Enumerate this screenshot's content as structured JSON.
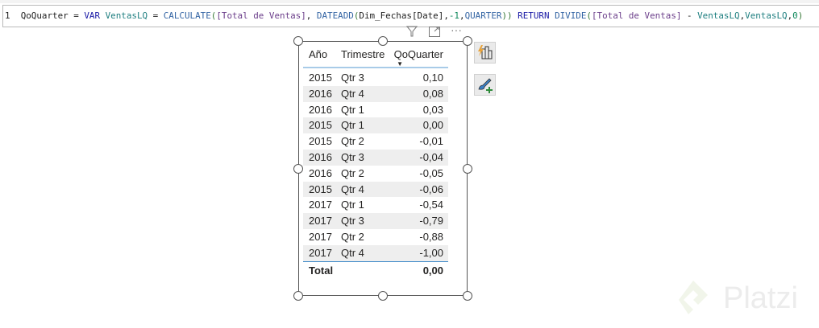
{
  "formula": {
    "line_number": "1",
    "tokens": [
      {
        "t": "QoQuarter = ",
        "c": ""
      },
      {
        "t": "VAR",
        "c": "kw"
      },
      {
        "t": " ",
        "c": ""
      },
      {
        "t": "VentasLQ",
        "c": "var"
      },
      {
        "t": " = ",
        "c": ""
      },
      {
        "t": "CALCULATE",
        "c": "fn"
      },
      {
        "t": "(",
        "c": "br"
      },
      {
        "t": "[Total de Ventas]",
        "c": "ms"
      },
      {
        "t": ", ",
        "c": ""
      },
      {
        "t": "DATEADD",
        "c": "fn"
      },
      {
        "t": "(",
        "c": "br"
      },
      {
        "t": "Dim_Fechas[Date]",
        "c": ""
      },
      {
        "t": ",",
        "c": ""
      },
      {
        "t": "-1",
        "c": "num"
      },
      {
        "t": ",",
        "c": ""
      },
      {
        "t": "QUARTER",
        "c": "fn"
      },
      {
        "t": "))",
        "c": "br"
      },
      {
        "t": " ",
        "c": ""
      },
      {
        "t": "RETURN",
        "c": "kw"
      },
      {
        "t": " ",
        "c": ""
      },
      {
        "t": "DIVIDE",
        "c": "fn"
      },
      {
        "t": "(",
        "c": "br"
      },
      {
        "t": "[Total de Ventas]",
        "c": "ms"
      },
      {
        "t": " - ",
        "c": ""
      },
      {
        "t": "VentasLQ",
        "c": "var"
      },
      {
        "t": ",",
        "c": ""
      },
      {
        "t": "VentasLQ",
        "c": "var"
      },
      {
        "t": ",",
        "c": ""
      },
      {
        "t": "0",
        "c": "num"
      },
      {
        "t": ")",
        "c": "br"
      }
    ]
  },
  "table": {
    "headers": [
      "Año",
      "Trimestre",
      "QoQuarter"
    ],
    "rows": [
      [
        "2015",
        "Qtr 3",
        "0,10"
      ],
      [
        "2016",
        "Qtr 4",
        "0,08"
      ],
      [
        "2016",
        "Qtr 1",
        "0,03"
      ],
      [
        "2015",
        "Qtr 1",
        "0,00"
      ],
      [
        "2015",
        "Qtr 2",
        "-0,01"
      ],
      [
        "2016",
        "Qtr 3",
        "-0,04"
      ],
      [
        "2016",
        "Qtr 2",
        "-0,05"
      ],
      [
        "2015",
        "Qtr 4",
        "-0,06"
      ],
      [
        "2017",
        "Qtr 1",
        "-0,54"
      ],
      [
        "2017",
        "Qtr 3",
        "-0,79"
      ],
      [
        "2017",
        "Qtr 2",
        "-0,88"
      ],
      [
        "2017",
        "Qtr 4",
        "-1,00"
      ]
    ],
    "total_label": "Total",
    "total_value": "0,00"
  },
  "visual_header": {
    "more_label": "···"
  },
  "watermark": {
    "brand": "Platzi"
  }
}
